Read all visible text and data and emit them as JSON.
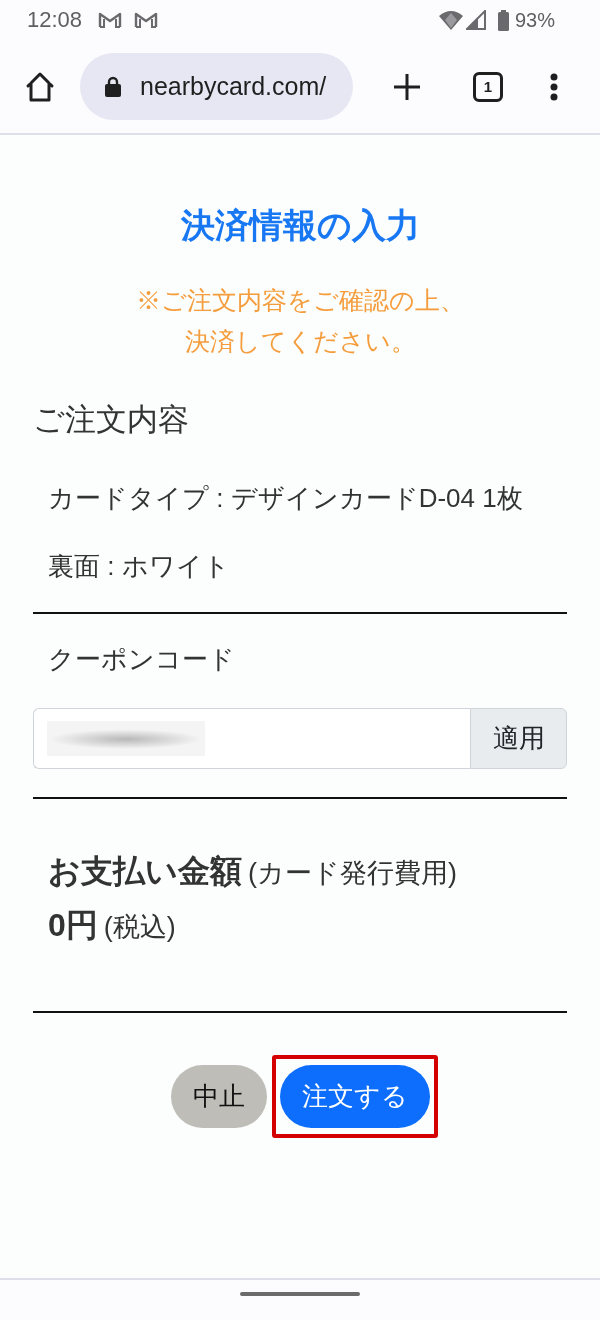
{
  "status_bar": {
    "time": "12:08",
    "battery": "93%"
  },
  "browser": {
    "url": "nearbycard.com/",
    "tab_count": "1"
  },
  "page": {
    "title": "決済情報の入力",
    "notice": "※ご注文内容をご確認の上、決済してください。",
    "order": {
      "heading": "ご注文内容",
      "lines": [
        "カードタイプ : デザインカードD-04 1枚",
        "裏面 : ホワイト"
      ]
    },
    "coupon": {
      "label": "クーポンコード",
      "value_blurred": true,
      "apply_button": "適用"
    },
    "payment": {
      "label": "お支払い金額",
      "note": "(カード発行費用)",
      "amount": "0円",
      "tax_note": "(税込)"
    },
    "buttons": [
      {
        "label": "中止",
        "kind": "secondary",
        "highlighted": false
      },
      {
        "label": "注文する",
        "kind": "primary",
        "highlighted": true
      }
    ]
  }
}
